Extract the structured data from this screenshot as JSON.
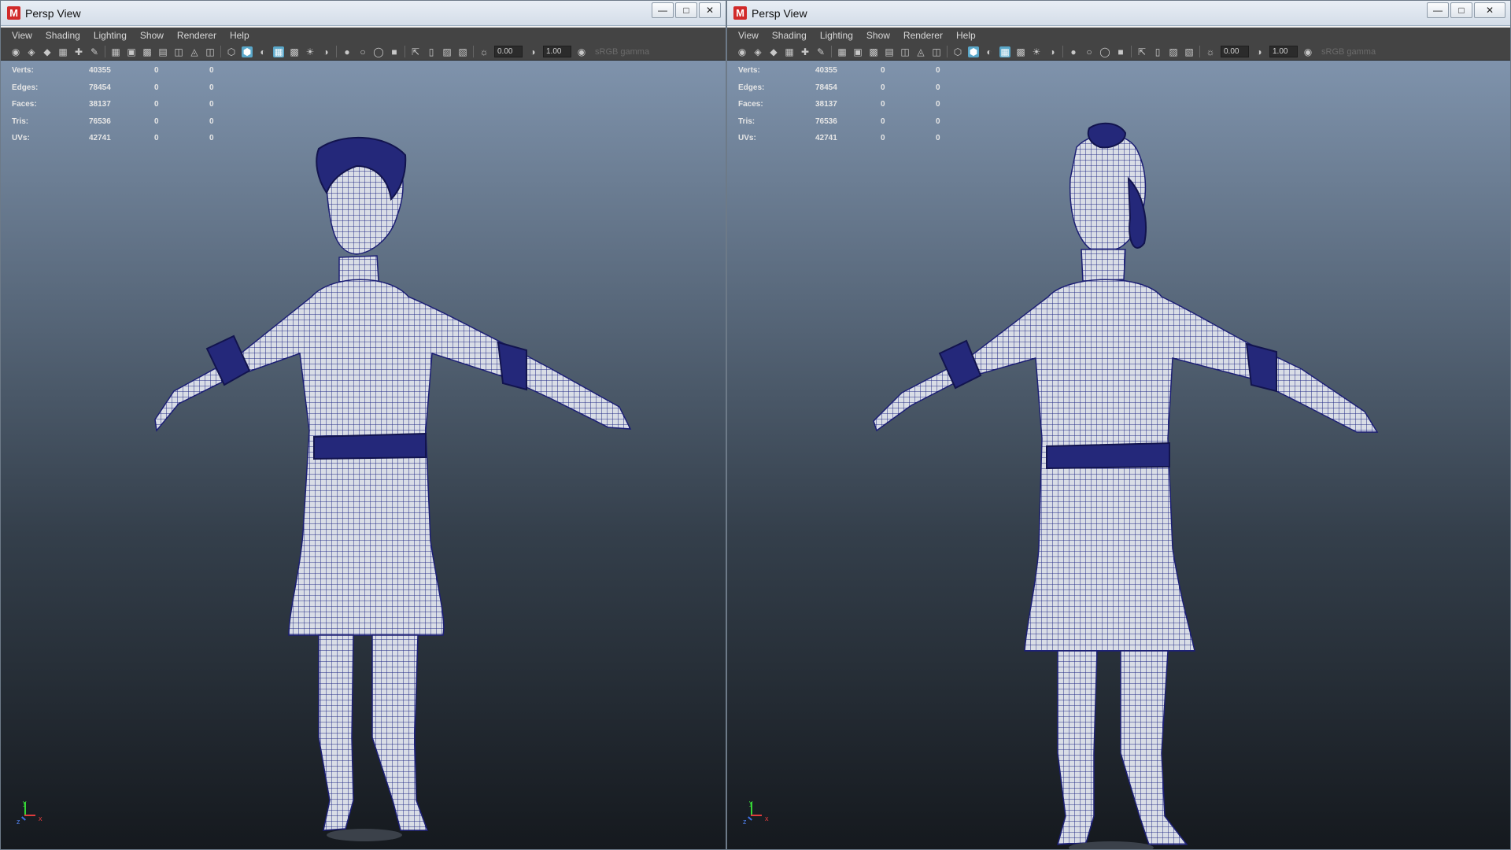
{
  "windows": [
    {
      "title": "Persp View",
      "logo": "M",
      "menu": [
        "View",
        "Shading",
        "Lighting",
        "Show",
        "Renderer",
        "Help"
      ],
      "toolbar": {
        "exposure": "0.00",
        "gamma": "1.00",
        "color_space": "sRGB gamma"
      },
      "stats": [
        {
          "label": "Verts:",
          "value": "40355",
          "sel": "0",
          "extra": "0"
        },
        {
          "label": "Edges:",
          "value": "78454",
          "sel": "0",
          "extra": "0"
        },
        {
          "label": "Faces:",
          "value": "38137",
          "sel": "0",
          "extra": "0"
        },
        {
          "label": "Tris:",
          "value": "76536",
          "sel": "0",
          "extra": "0"
        },
        {
          "label": "UVs:",
          "value": "42741",
          "sel": "0",
          "extra": "0"
        }
      ],
      "view": "front",
      "axis": {
        "x": "x",
        "y": "y",
        "z": "z"
      }
    },
    {
      "title": "Persp View",
      "logo": "M",
      "menu": [
        "View",
        "Shading",
        "Lighting",
        "Show",
        "Renderer",
        "Help"
      ],
      "toolbar": {
        "exposure": "0.00",
        "gamma": "1.00",
        "color_space": "sRGB gamma"
      },
      "stats": [
        {
          "label": "Verts:",
          "value": "40355",
          "sel": "0",
          "extra": "0"
        },
        {
          "label": "Edges:",
          "value": "78454",
          "sel": "0",
          "extra": "0"
        },
        {
          "label": "Faces:",
          "value": "38137",
          "sel": "0",
          "extra": "0"
        },
        {
          "label": "Tris:",
          "value": "76536",
          "sel": "0",
          "extra": "0"
        },
        {
          "label": "UVs:",
          "value": "42741",
          "sel": "0",
          "extra": "0"
        }
      ],
      "view": "back",
      "axis": {
        "x": "x",
        "y": "y",
        "z": "z"
      }
    }
  ],
  "colors": {
    "wire": "#2a2a8a",
    "mesh_fill": "#d9dde6",
    "accent_logo": "#d12a2a"
  }
}
